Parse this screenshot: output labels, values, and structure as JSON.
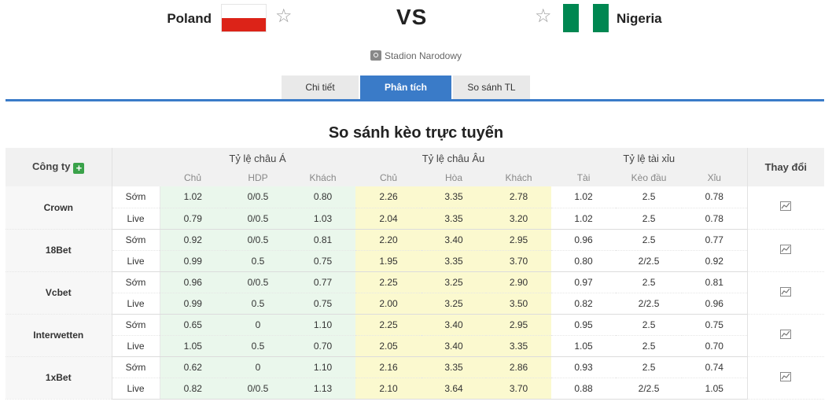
{
  "match": {
    "home_team": "Poland",
    "away_team": "Nigeria",
    "vs": "VS",
    "venue": "Stadion Narodowy"
  },
  "tabs": [
    "Chi tiết",
    "Phân tích",
    "So sánh TL"
  ],
  "active_tab": "Phân tích",
  "section_title": "So sánh kèo trực tuyến",
  "table": {
    "company_header": "Công ty",
    "change_header": "Thay đổi",
    "groups": {
      "asian": {
        "title": "Tỷ lệ châu Á",
        "cols": [
          "Chủ",
          "HDP",
          "Khách"
        ]
      },
      "euro": {
        "title": "Tỷ lệ châu Âu",
        "cols": [
          "Chủ",
          "Hòa",
          "Khách"
        ]
      },
      "ou": {
        "title": "Tỷ lệ tài xỉu",
        "cols": [
          "Tài",
          "Kèo đầu",
          "Xỉu"
        ]
      }
    },
    "row_types": {
      "early": "Sớm",
      "live": "Live"
    },
    "companies": [
      {
        "name": "Crown",
        "early": {
          "asian": [
            "1.02",
            "0/0.5",
            "0.80"
          ],
          "euro": [
            "2.26",
            "3.35",
            "2.78"
          ],
          "ou": [
            "1.02",
            "2.5",
            "0.78"
          ]
        },
        "live": {
          "asian": [
            "0.79",
            "0/0.5",
            "1.03"
          ],
          "euro": [
            "2.04",
            "3.35",
            "3.20"
          ],
          "ou": [
            "1.02",
            "2.5",
            "0.78"
          ]
        }
      },
      {
        "name": "18Bet",
        "early": {
          "asian": [
            "0.92",
            "0/0.5",
            "0.81"
          ],
          "euro": [
            "2.20",
            "3.40",
            "2.95"
          ],
          "ou": [
            "0.96",
            "2.5",
            "0.77"
          ]
        },
        "live": {
          "asian": [
            "0.99",
            "0.5",
            "0.75"
          ],
          "euro": [
            "1.95",
            "3.35",
            "3.70"
          ],
          "ou": [
            "0.80",
            "2/2.5",
            "0.92"
          ]
        }
      },
      {
        "name": "Vcbet",
        "early": {
          "asian": [
            "0.96",
            "0/0.5",
            "0.77"
          ],
          "euro": [
            "2.25",
            "3.25",
            "2.90"
          ],
          "ou": [
            "0.97",
            "2.5",
            "0.81"
          ]
        },
        "live": {
          "asian": [
            "0.99",
            "0.5",
            "0.75"
          ],
          "euro": [
            "2.00",
            "3.25",
            "3.50"
          ],
          "ou": [
            "0.82",
            "2/2.5",
            "0.96"
          ]
        }
      },
      {
        "name": "Interwetten",
        "early": {
          "asian": [
            "0.65",
            "0",
            "1.10"
          ],
          "euro": [
            "2.25",
            "3.40",
            "2.95"
          ],
          "ou": [
            "0.95",
            "2.5",
            "0.75"
          ]
        },
        "live": {
          "asian": [
            "1.05",
            "0.5",
            "0.70"
          ],
          "euro": [
            "2.05",
            "3.40",
            "3.35"
          ],
          "ou": [
            "1.05",
            "2.5",
            "0.70"
          ]
        }
      },
      {
        "name": "1xBet",
        "early": {
          "asian": [
            "0.62",
            "0",
            "1.10"
          ],
          "euro": [
            "2.16",
            "3.35",
            "2.86"
          ],
          "ou": [
            "0.93",
            "2.5",
            "0.74"
          ]
        },
        "live": {
          "asian": [
            "0.82",
            "0/0.5",
            "1.13"
          ],
          "euro": [
            "2.10",
            "3.64",
            "3.70"
          ],
          "ou": [
            "0.88",
            "2/2.5",
            "1.05"
          ]
        }
      }
    ]
  },
  "colors": {
    "accent": "#3a7bc8",
    "asian_bg": "#eaf7ec",
    "euro_bg": "#fbf9cf",
    "poland_red": "#dc2318",
    "nigeria_green": "#008751"
  },
  "icons": {
    "favorite": "star-outline-icon",
    "venue": "stadium-icon",
    "add": "plus-icon",
    "change": "line-chart-icon"
  }
}
